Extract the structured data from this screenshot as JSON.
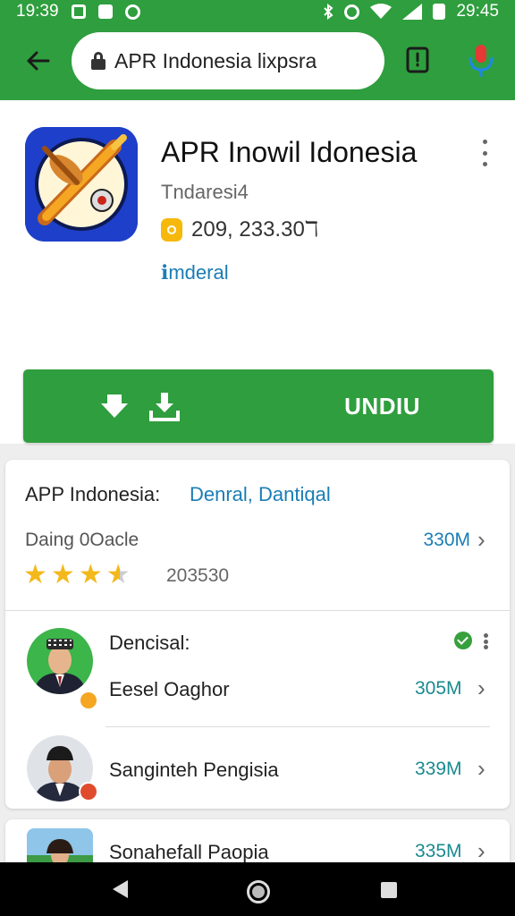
{
  "status_bar": {
    "time_left": "19:39",
    "time_right": "29:45",
    "icons_left": [
      "notification-icon",
      "square-icon",
      "shield-icon"
    ],
    "icons_right": [
      "bluetooth-icon",
      "alarm-icon",
      "wifi-icon",
      "signal-icon",
      "battery-icon"
    ]
  },
  "app_bar": {
    "url": "APR Indonesia  lixpsra",
    "icons": [
      "back-arrow-icon",
      "lock-icon",
      "bookmark-icon",
      "mic-icon"
    ]
  },
  "app": {
    "title": "APR Inowil Idonesia",
    "developer": "Tndaresi4",
    "rating_text": "209, 233.30ℸ",
    "tag": "ℹmderal",
    "install_label": "UNDIU",
    "icon": "paintbrush-pen-icon",
    "accent_color": "#2f9e3e",
    "icon_bg_color": "#1e3fc9"
  },
  "card": {
    "title": "APP Indonesia:",
    "link": "Denral, Dantiqal",
    "summary_label": "Daing 0Oacle",
    "summary_size": "330M",
    "star_rating": 4.5,
    "count": "203530",
    "rows": [
      {
        "title": "Dencisal:",
        "subtitle": "Eesel Oaghor",
        "size": "305M"
      },
      {
        "title": "Sanginteh Pengisia",
        "size": "339M"
      },
      {
        "title": "Sonahefall Paopia",
        "size": "335M"
      }
    ]
  },
  "nav": {
    "icons": [
      "nav-back-icon",
      "nav-home-icon",
      "nav-recents-icon"
    ]
  }
}
